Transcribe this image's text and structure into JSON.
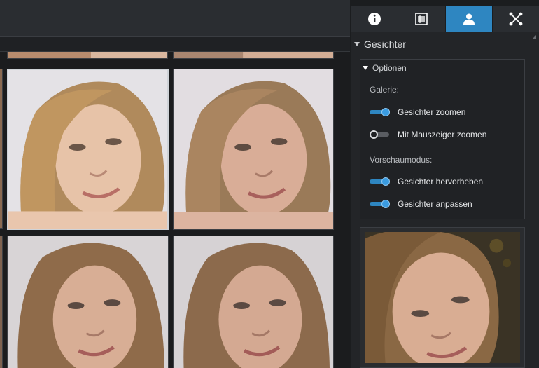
{
  "tabs": [
    {
      "icon": "info-icon",
      "active": false
    },
    {
      "icon": "list-icon",
      "active": false
    },
    {
      "icon": "person-icon",
      "active": true
    },
    {
      "icon": "network-icon",
      "active": false
    }
  ],
  "panel": {
    "section_title": "Gesichter",
    "options_title": "Optionen",
    "gallery_label": "Galerie:",
    "zoom_faces_label": "Gesichter zoomen",
    "zoom_faces_on": true,
    "mouse_zoom_label": "Mit Mauszeiger zoomen",
    "mouse_zoom_on": false,
    "preview_mode_label": "Vorschaumodus:",
    "highlight_faces_label": "Gesichter hervorheben",
    "highlight_faces_on": true,
    "fit_faces_label": "Gesichter anpassen",
    "fit_faces_on": true
  },
  "colors": {
    "accent": "#2e86c1",
    "panel_bg": "#232528",
    "gallery_bg": "#1b1c1e"
  }
}
